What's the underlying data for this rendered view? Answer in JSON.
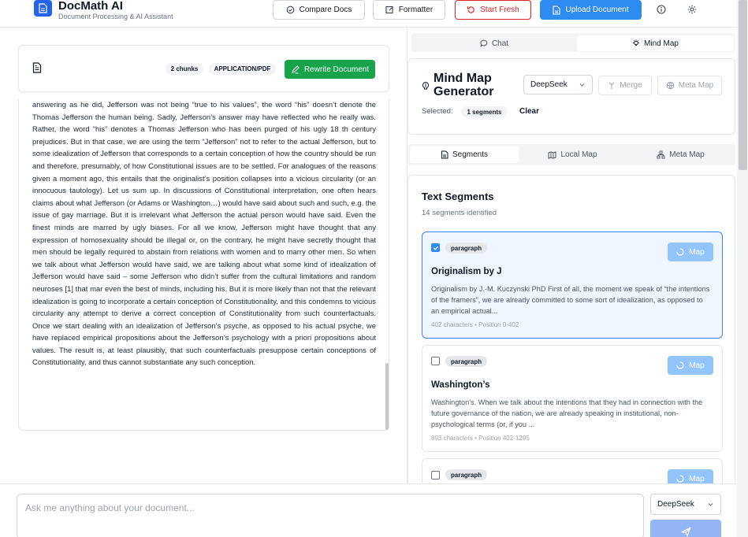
{
  "app": {
    "title": "DocMath AI",
    "subtitle": "Document Processing & AI Assistant"
  },
  "header": {
    "compare_label": "Compare Docs",
    "formatter_label": "Formatter",
    "start_fresh_label": "Start Fresh",
    "upload_label": "Upload Document",
    "icons": [
      "file-icon",
      "compare-icon",
      "edit-icon",
      "refresh-icon",
      "upload-icon",
      "info-icon",
      "gear-icon"
    ]
  },
  "document": {
    "chunks_tag": "2 chunks",
    "type_tag": "APPLICATION/PDF",
    "rewrite_label": "Rewrite Document",
    "text": "answering as he did, Jefferson was not being “true to his values”, the word “his” doesn’t denote the Thomas Jefferson the human being. Sadly, Jefferson’s answer may have reflected who he really was. Rather, the word “his” denotes a Thomas Jefferson who has been purged of his ugly 18 th century prejudices. But in that case, we are using the term “Jefferson” not to refer to the actual Jefferson, but to some idealization of Jefferson that corresponds to a certain conception of how the country should be run and therefore, presumably, of how Constitutional issues are to be settled. For analogues of the reasons given a moment ago, this entails that the originalist’s position collapses into a vicious circularity (or an innocuous tautology). Let us sum up. In discussions of Constitutional interpretation, one often hears claims about what Jefferson (or Adams or Washington…) would have said about such and such, e.g. the issue of gay marriage. But it is irrelevant what Jefferson the actual person would have said. Even the finest minds are marred by ugly biases. For all we know, Jefferson might have thought that any expression of homosexuality should be illegal or, on the contrary, he might have secretly thought that men should be legally required to abstain from relations with women and to marry other men. So when we talk about what Jefferson would have said, we are talking about what some kind of idealization of Jefferson would have said – some Jefferson who didn’t suffer from the cultural limitations and random neuroses [1] that mar even the best of minds, including his. But it is more likely than not that the relevant idealization is going to incorporate a certain conception of Constitutionality, and this condemns to vicious circularity any attempt to derive a correct conception of Constitutionality from such counterfactuals. Once we start dealing with an idealization of Jefferson’s psyche, as opposed to his actual psyche, we have replaced empirical propositions about the Jefferson’s psychology with a priori propositions about values. The result is, at least plausibly, that such counterfactuals presuppose certain conceptions of Constitutionality, and thus cannot substantiate any such conception."
  },
  "right_tabs": {
    "chat_label": "Chat",
    "mindmap_label": "Mind Map",
    "active": "Mind Map"
  },
  "mindmap": {
    "title": "Mind Map Generator",
    "model_value": "DeepSeek",
    "merge_label": "Merge",
    "meta_map_label": "Meta Map",
    "selected_label": "Selected:",
    "selected_count": "1 segments",
    "clear_label": "Clear"
  },
  "sub_tabs": {
    "segments_label": "Segments",
    "local_map_label": "Local Map",
    "meta_map_label": "Meta Map",
    "active": "Segments"
  },
  "segments": {
    "title": "Text Segments",
    "subtitle": "14 segments identified",
    "map_label": "Map",
    "items": [
      {
        "type": "paragraph",
        "title": "Originalism by J",
        "text": "Originalism by J.-M. Kuczynski PhD First of all, the moment we speak of “the intentions of the framers”, we are already committed to some sort of idealization, as opposed to an empirical actual...",
        "meta": "402 characters • Position 0-402",
        "checked": true
      },
      {
        "type": "paragraph",
        "title": "Washington’s",
        "text": "Washington’s. When we talk about the intentions that they had in connection with the future governance of the nation, we are already speaking in institutional, non-psychological terms (or, if you ...",
        "meta": "893 characters • Position 402-1295",
        "checked": false
      },
      {
        "type": "paragraph",
        "checked": false
      }
    ]
  },
  "chat": {
    "placeholder": "Ask me anything about your document...",
    "model_value": "DeepSeek"
  }
}
